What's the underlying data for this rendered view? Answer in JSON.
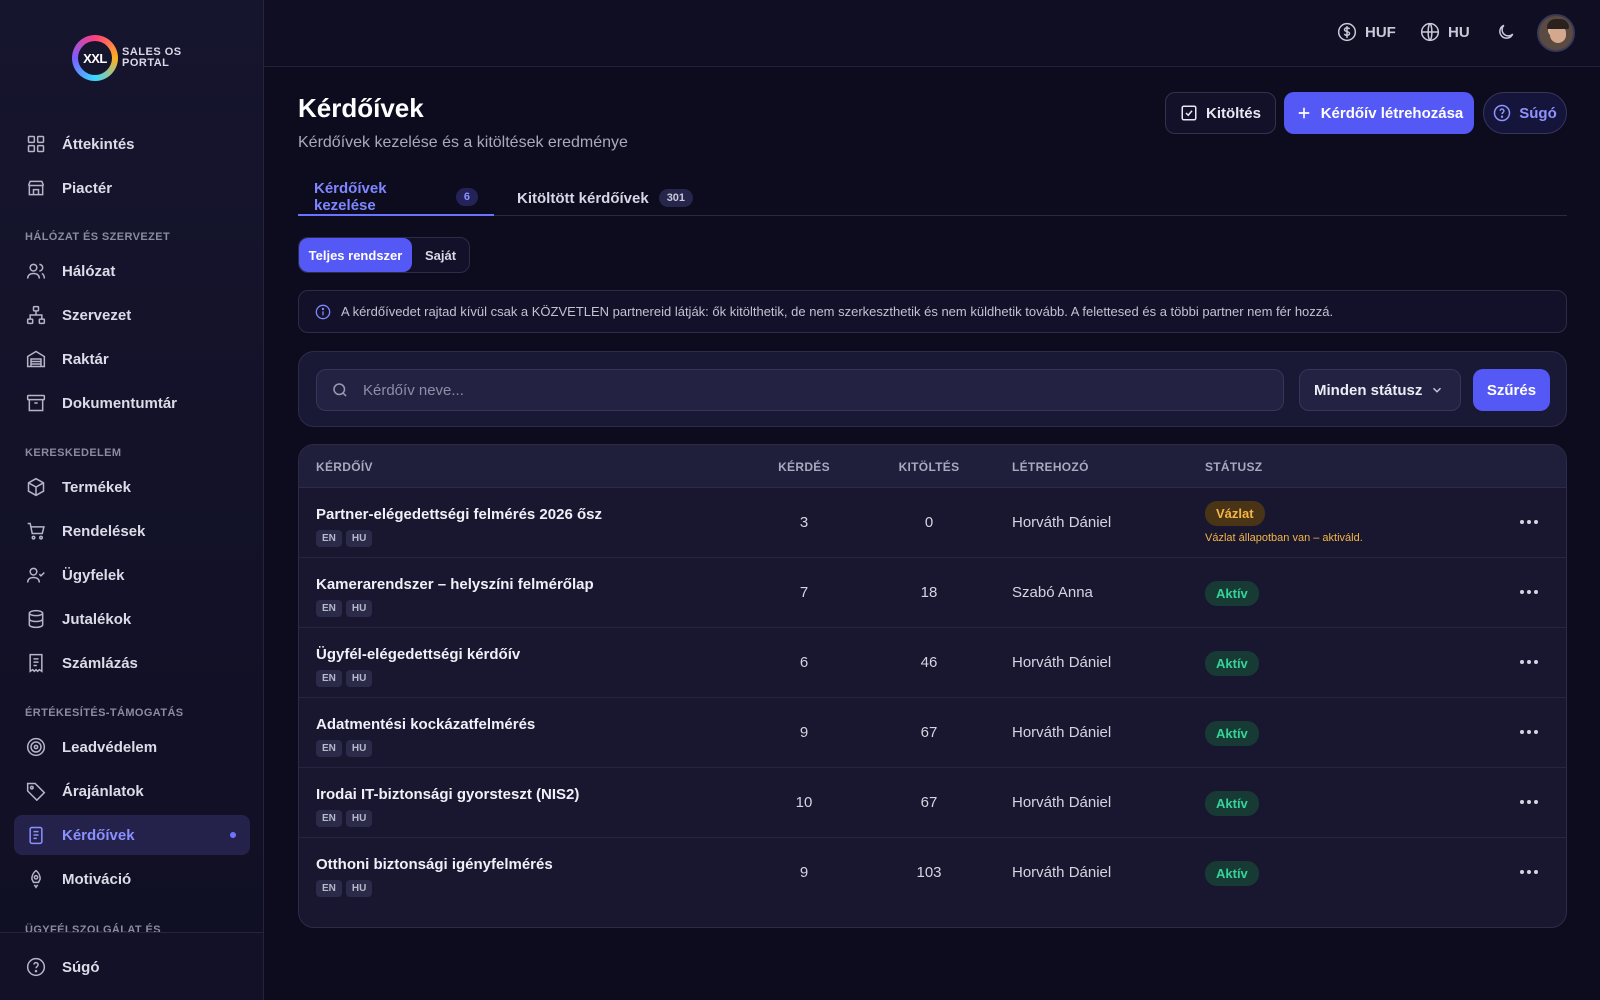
{
  "brand": {
    "logo_mark": "XXL",
    "logo_line1": "SALES OS",
    "logo_line2": "PORTAL"
  },
  "sidebar": {
    "items": [
      {
        "label": "Áttekintés",
        "icon": "grid-icon"
      },
      {
        "label": "Piactér",
        "icon": "store-icon"
      },
      {
        "section": "HÁLÓZAT ÉS SZERVEZET"
      },
      {
        "label": "Hálózat",
        "icon": "users-icon"
      },
      {
        "label": "Szervezet",
        "icon": "org-chart-icon"
      },
      {
        "label": "Raktár",
        "icon": "warehouse-icon"
      },
      {
        "label": "Dokumentumtár",
        "icon": "archive-icon"
      },
      {
        "section": "KERESKEDELEM"
      },
      {
        "label": "Termékek",
        "icon": "package-icon"
      },
      {
        "label": "Rendelések",
        "icon": "cart-icon"
      },
      {
        "label": "Ügyfelek",
        "icon": "user-check-icon"
      },
      {
        "label": "Jutalékok",
        "icon": "database-icon"
      },
      {
        "label": "Számlázás",
        "icon": "receipt-icon"
      },
      {
        "section": "ÉRTÉKESÍTÉS-TÁMOGATÁS"
      },
      {
        "label": "Leadvédelem",
        "icon": "target-icon"
      },
      {
        "label": "Árajánlatok",
        "icon": "tag-icon"
      },
      {
        "label": "Kérdőívek",
        "icon": "clipboard-icon",
        "active": true
      },
      {
        "label": "Motiváció",
        "icon": "rocket-icon"
      },
      {
        "section": "ÜGYFÉLSZOLGÁLAT ÉS"
      }
    ],
    "help_label": "Súgó"
  },
  "topbar": {
    "currency": "HUF",
    "language": "HU"
  },
  "page": {
    "title": "Kérdőívek",
    "subtitle": "Kérdőívek kezelése és a kitöltések eredménye",
    "actions": {
      "fill_label": "Kitöltés",
      "create_label": "Kérdőív létrehozása",
      "help_label": "Súgó"
    },
    "tabs": [
      {
        "label": "Kérdőívek kezelése",
        "count": "6",
        "active": true
      },
      {
        "label": "Kitöltött kérdőívek",
        "count": "301"
      }
    ],
    "scope": {
      "option_all": "Teljes rendszer",
      "option_own": "Saját"
    },
    "info": "A kérdőívedet rajtad kívül csak a KÖZVETLEN partnereid látják: ők kitölthetik, de nem szerkeszthetik és nem küldhetik tovább. A felettesed és a többi partner nem fér hozzá.",
    "filter": {
      "search_placeholder": "Kérdőív neve...",
      "status_select": "Minden státusz",
      "button": "Szűrés"
    },
    "table": {
      "columns": [
        "KÉRDŐÍV",
        "KÉRDÉS",
        "KITÖLTÉS",
        "LÉTREHOZÓ",
        "STÁTUSZ"
      ],
      "rows": [
        {
          "title": "Partner-elégedettségi felmérés 2026 ősz",
          "langs": [
            "EN",
            "HU"
          ],
          "questions": "3",
          "fills": "0",
          "creator": "Horváth Dániel",
          "status": "Vázlat",
          "status_type": "draft",
          "note": "Vázlat állapotban van – aktiváld."
        },
        {
          "title": "Kamerarendszer – helyszíni felmérőlap",
          "langs": [
            "EN",
            "HU"
          ],
          "questions": "7",
          "fills": "18",
          "creator": "Szabó Anna",
          "status": "Aktív",
          "status_type": "active"
        },
        {
          "title": "Ügyfél-elégedettségi kérdőív",
          "langs": [
            "EN",
            "HU"
          ],
          "questions": "6",
          "fills": "46",
          "creator": "Horváth Dániel",
          "status": "Aktív",
          "status_type": "active"
        },
        {
          "title": "Adatmentési kockázatfelmérés",
          "langs": [
            "EN",
            "HU"
          ],
          "questions": "9",
          "fills": "67",
          "creator": "Horváth Dániel",
          "status": "Aktív",
          "status_type": "active"
        },
        {
          "title": "Irodai IT-biztonsági gyorsteszt (NIS2)",
          "langs": [
            "EN",
            "HU"
          ],
          "questions": "10",
          "fills": "67",
          "creator": "Horváth Dániel",
          "status": "Aktív",
          "status_type": "active"
        },
        {
          "title": "Otthoni biztonsági igényfelmérés",
          "langs": [
            "EN",
            "HU"
          ],
          "questions": "9",
          "fills": "103",
          "creator": "Horváth Dániel",
          "status": "Aktív",
          "status_type": "active"
        }
      ]
    }
  },
  "colors": {
    "accent": "#5458f5",
    "active_status": "#34d399",
    "draft_status": "#f5b545"
  }
}
